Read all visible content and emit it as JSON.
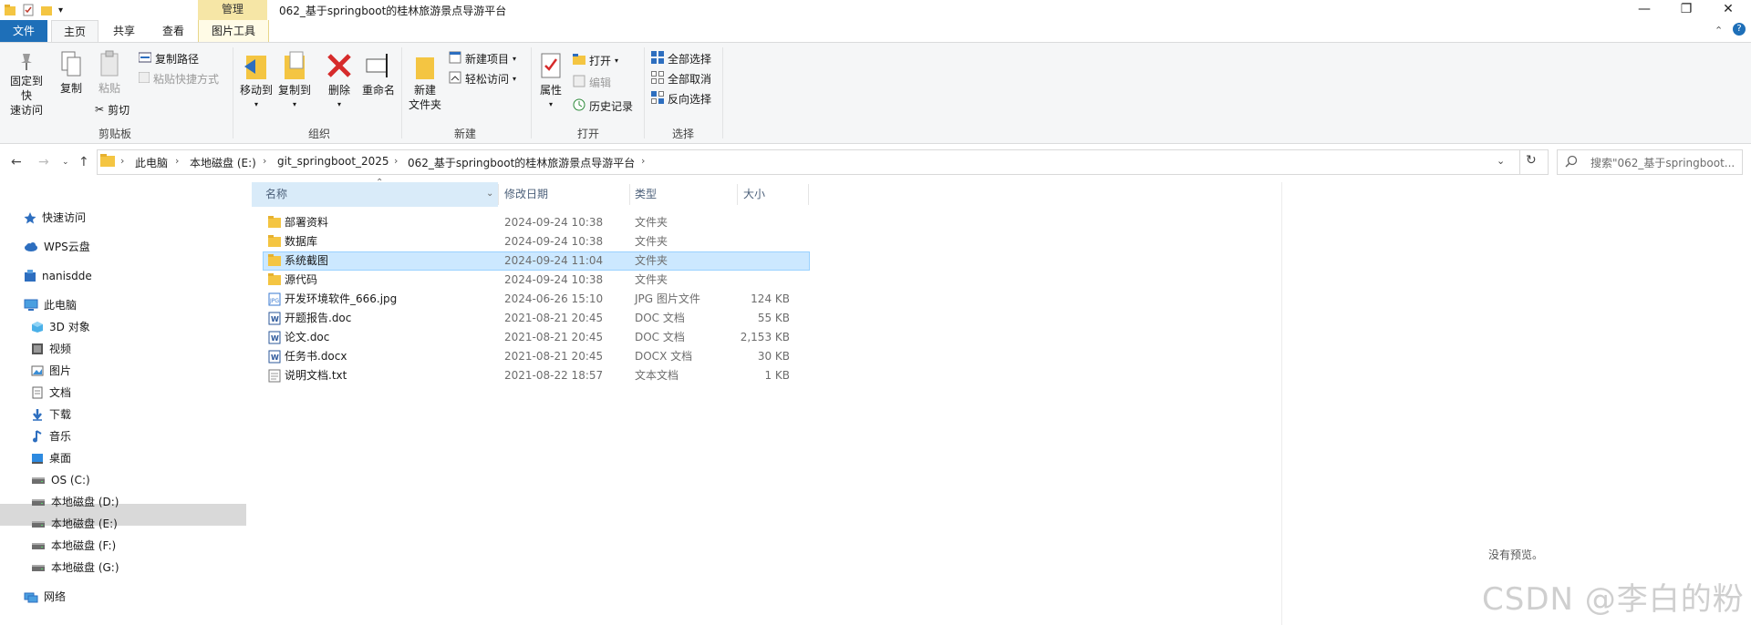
{
  "window": {
    "title": "062_基于springboot的桂林旅游景点导游平台",
    "context_tab_header": "管理",
    "min": "—",
    "max": "❐",
    "close": "✕"
  },
  "tabs": {
    "file": "文件",
    "home": "主页",
    "share": "共享",
    "view": "查看",
    "picture_tools": "图片工具"
  },
  "ribbon": {
    "pin_quick": "固定到快\n速访问",
    "pin_quick_l1": "固定到快",
    "pin_quick_l2": "速访问",
    "copy": "复制",
    "paste": "粘贴",
    "copy_path": "复制路径",
    "paste_shortcut": "粘贴快捷方式",
    "cut": "剪切",
    "clipboard": "剪贴板",
    "move_to": "移动到",
    "copy_to": "复制到",
    "delete": "删除",
    "rename": "重命名",
    "organize": "组织",
    "new_folder_l1": "新建",
    "new_folder_l2": "文件夹",
    "new_item": "新建项目",
    "easy_access": "轻松访问",
    "new": "新建",
    "properties": "属性",
    "open": "打开",
    "edit": "编辑",
    "history": "历史记录",
    "open_group": "打开",
    "select_all": "全部选择",
    "select_none": "全部取消",
    "invert": "反向选择",
    "select": "选择"
  },
  "address": {
    "crumbs": [
      "此电脑",
      "本地磁盘 (E:)",
      "git_springboot_2025",
      "062_基于springboot的桂林旅游景点导游平台"
    ],
    "search_placeholder": "搜索\"062_基于springboot..."
  },
  "sidebar": {
    "items": [
      "快速访问",
      "WPS云盘",
      "nanisdde",
      "此电脑",
      "3D 对象",
      "视频",
      "图片",
      "文档",
      "下载",
      "音乐",
      "桌面",
      "OS (C:)",
      "本地磁盘 (D:)",
      "本地磁盘 (E:)",
      "本地磁盘 (F:)",
      "本地磁盘 (G:)",
      "网络"
    ]
  },
  "columns": {
    "name": "名称",
    "date": "修改日期",
    "type": "类型",
    "size": "大小"
  },
  "files": [
    {
      "name": "部署资料",
      "date": "2024-09-24 10:38",
      "type": "文件夹",
      "size": ""
    },
    {
      "name": "数据库",
      "date": "2024-09-24 10:38",
      "type": "文件夹",
      "size": ""
    },
    {
      "name": "系统截图",
      "date": "2024-09-24 11:04",
      "type": "文件夹",
      "size": ""
    },
    {
      "name": "源代码",
      "date": "2024-09-24 10:38",
      "type": "文件夹",
      "size": ""
    },
    {
      "name": "开发环境软件_666.jpg",
      "date": "2024-06-26 15:10",
      "type": "JPG 图片文件",
      "size": "124 KB"
    },
    {
      "name": "开题报告.doc",
      "date": "2021-08-21 20:45",
      "type": "DOC 文档",
      "size": "55 KB"
    },
    {
      "name": "论文.doc",
      "date": "2021-08-21 20:45",
      "type": "DOC 文档",
      "size": "2,153 KB"
    },
    {
      "name": "任务书.docx",
      "date": "2021-08-21 20:45",
      "type": "DOCX 文档",
      "size": "30 KB"
    },
    {
      "name": "说明文档.txt",
      "date": "2021-08-22 18:57",
      "type": "文本文档",
      "size": "1 KB"
    }
  ],
  "preview": {
    "empty_text": "没有预览。"
  },
  "watermark": "CSDN @李白的粉"
}
